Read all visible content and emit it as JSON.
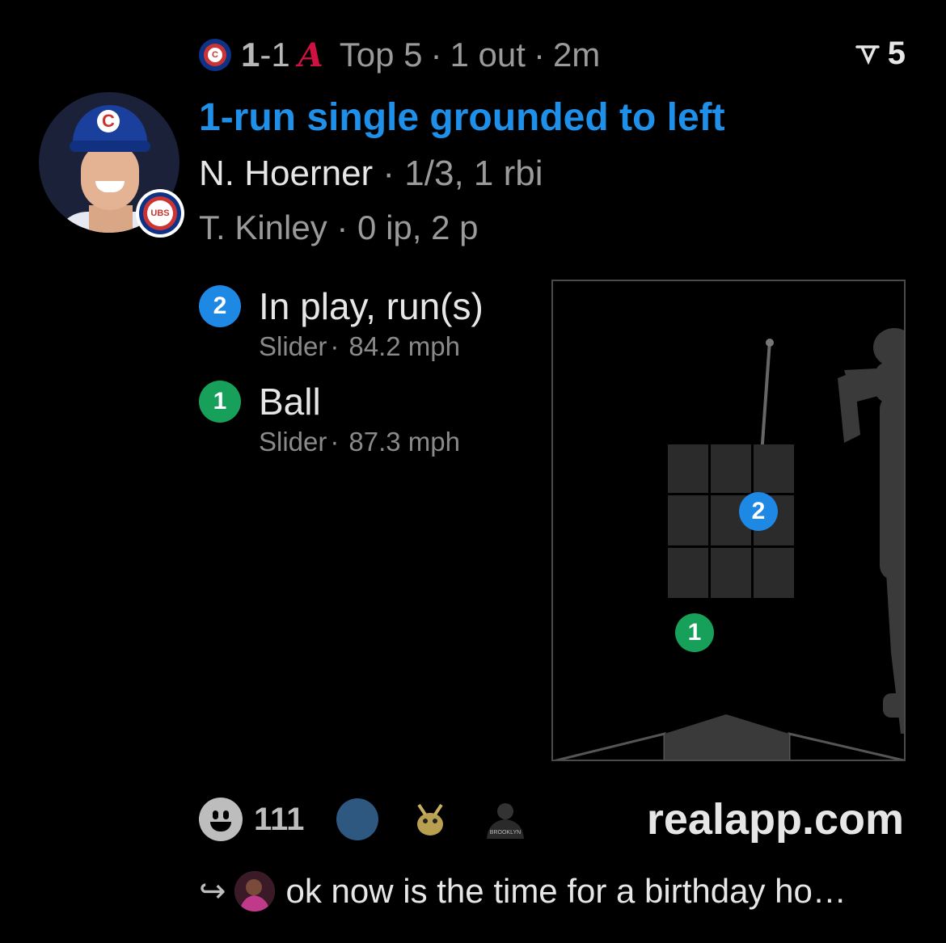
{
  "header": {
    "home_score": "1",
    "separator": "-",
    "away_score": "1",
    "inning": "Top 5",
    "outs": "1 out",
    "time_ago": "2m",
    "divider": "·",
    "home_team_icon": "cubs-logo",
    "away_team_icon": "braves-logo",
    "braves_glyph": "A"
  },
  "reactions_top": {
    "icon": "reaction-v-icon",
    "count": "5"
  },
  "play": {
    "headline": "1-run single grounded to left",
    "batter_name": "N. Hoerner",
    "batter_stat": " · 1/3, 1 rbi",
    "pitcher_line": "T. Kinley · 0 ip, 2 p"
  },
  "pitches": [
    {
      "number": "2",
      "result": "In play, run(s)",
      "type": "Slider",
      "sep": "·",
      "speed": "84.2 mph",
      "color": "#1e88e5"
    },
    {
      "number": "1",
      "result": "Ball",
      "type": "Slider",
      "sep": "·",
      "speed": "87.3 mph",
      "color": "#16a05a"
    }
  ],
  "footer": {
    "reaction_count": "111",
    "site": "realapp.com"
  },
  "reply": {
    "text": "ok now is the time for a birthday ho…"
  },
  "colors": {
    "accent_blue": "#1e90ea",
    "cubs_blue": "#0e3386",
    "cubs_red": "#cc3433",
    "braves_red": "#ce1141"
  }
}
